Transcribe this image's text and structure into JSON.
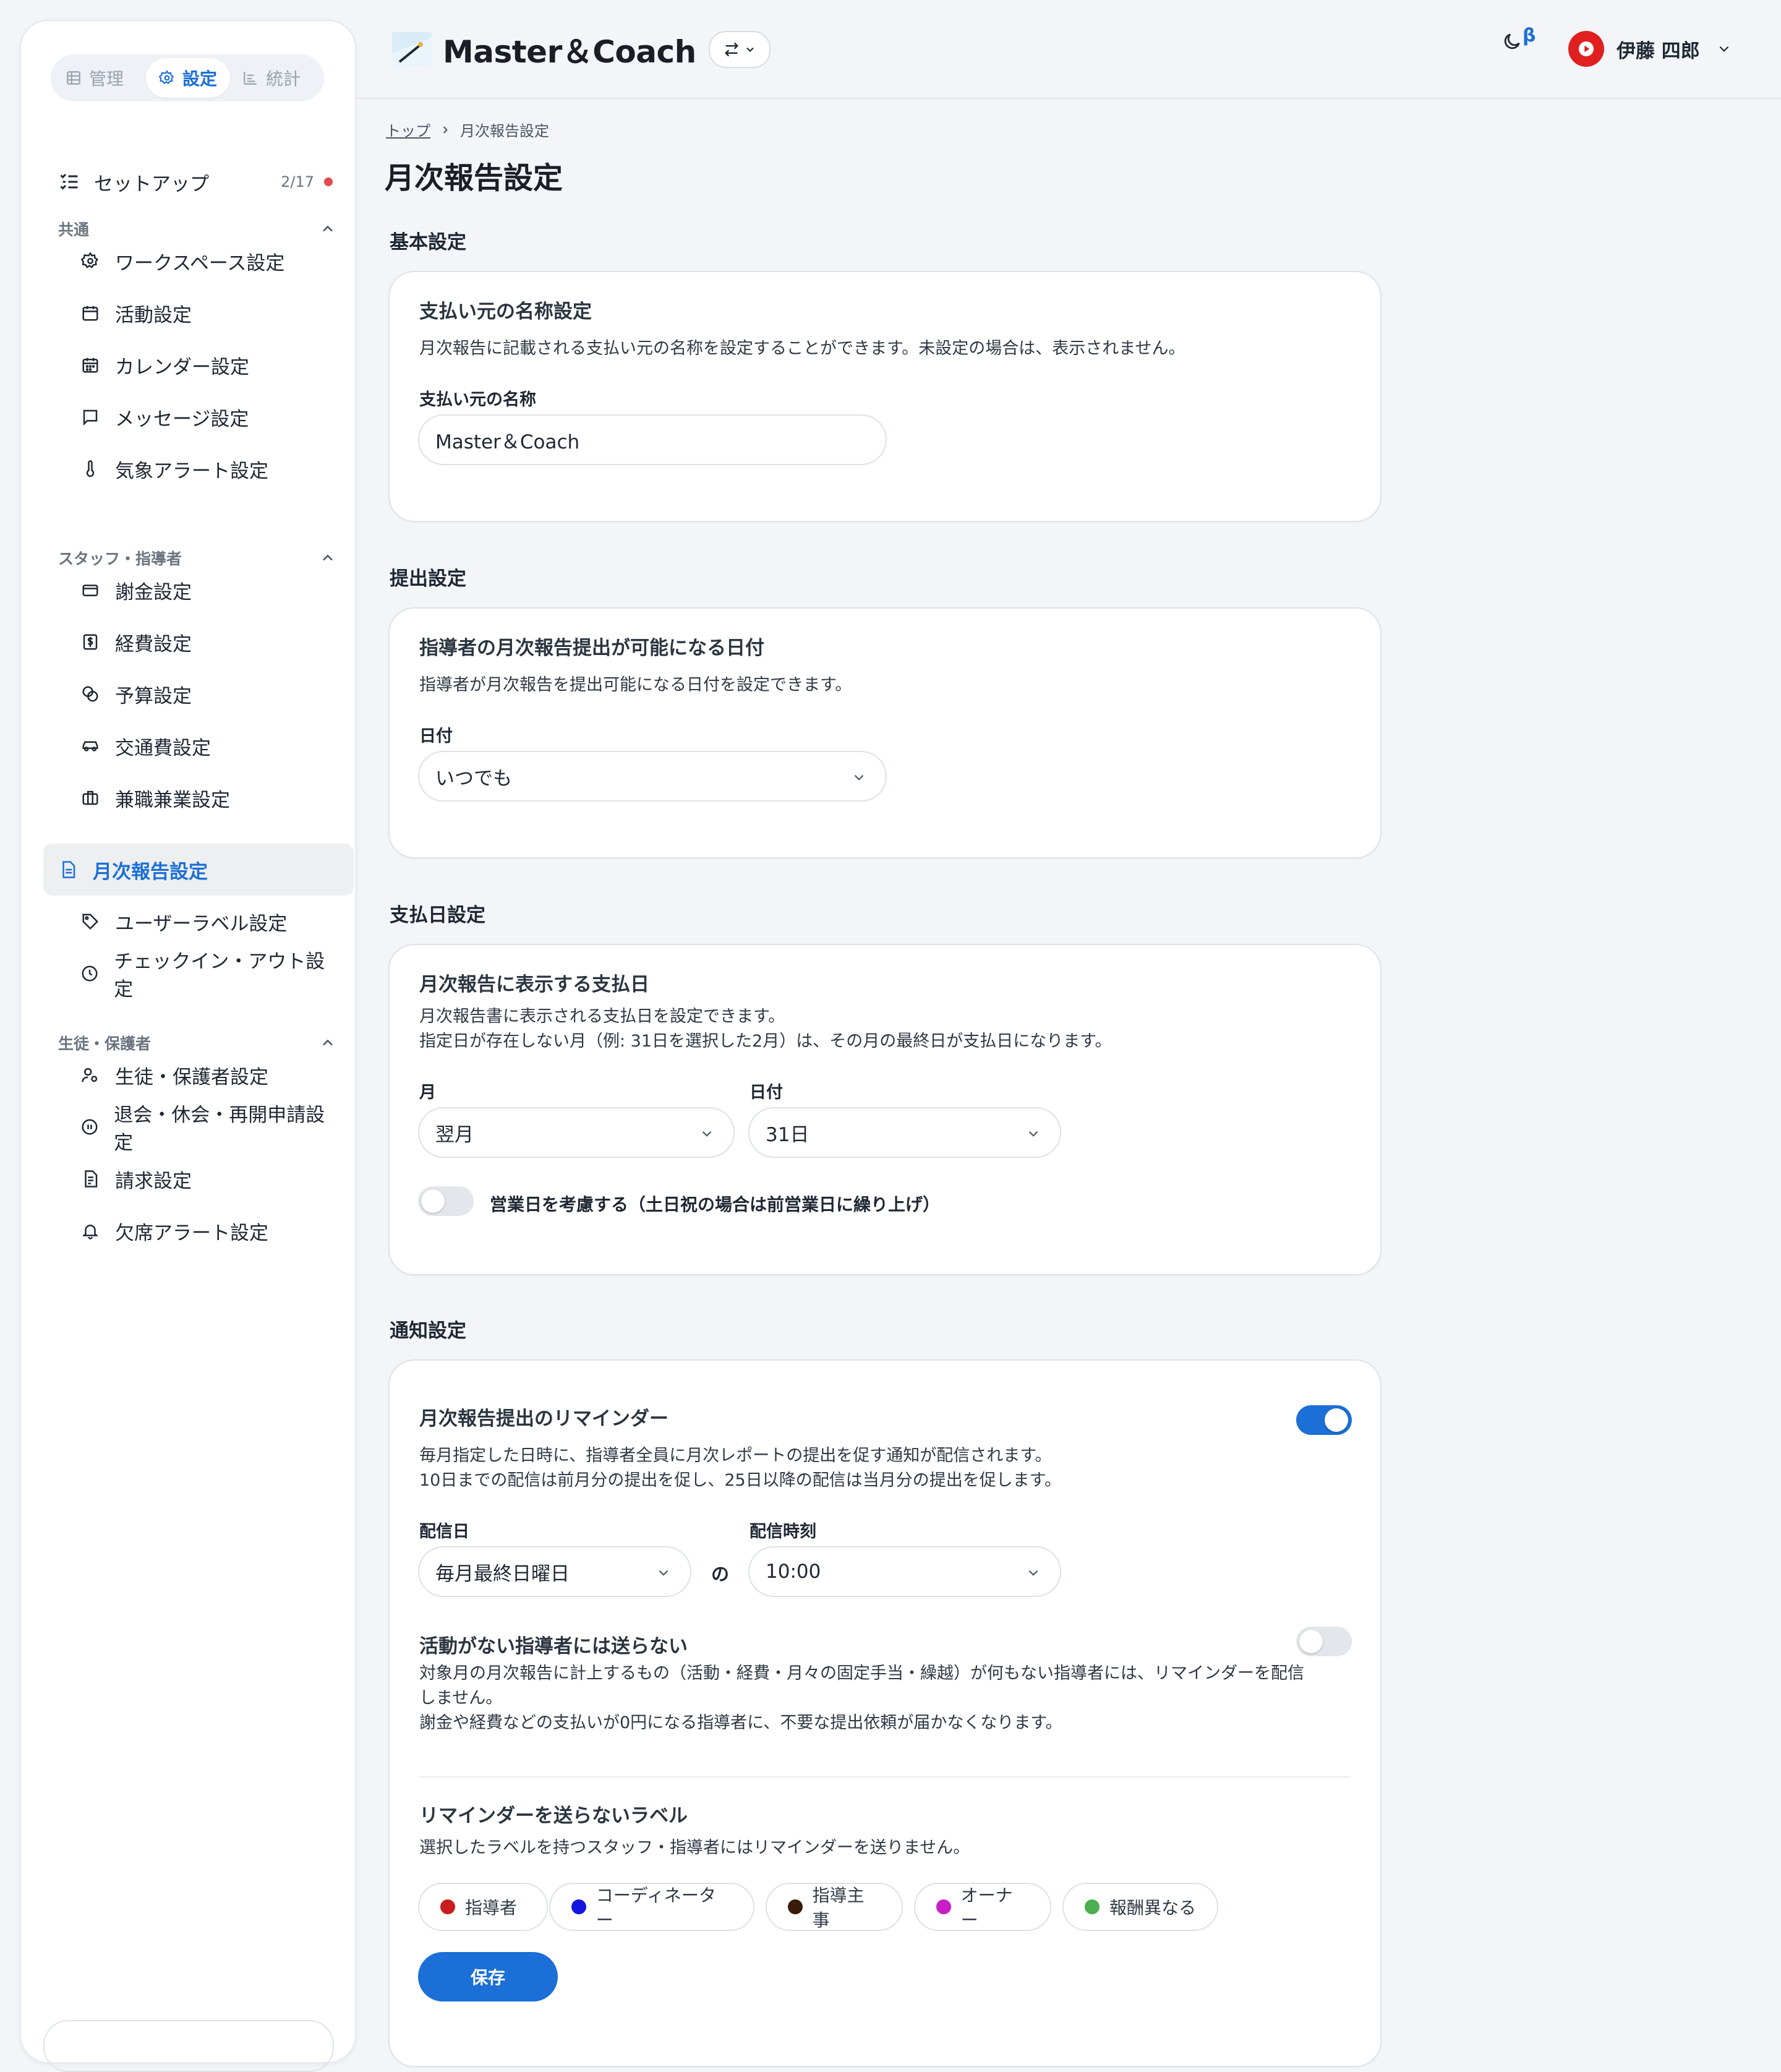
{
  "sidebar": {
    "segments": [
      {
        "label": "管理",
        "icon": "grid-icon"
      },
      {
        "label": "設定",
        "icon": "gear-icon"
      },
      {
        "label": "統計",
        "icon": "chart-icon"
      }
    ],
    "setup": {
      "label": "セットアップ",
      "progress": "2/17"
    },
    "sections": [
      {
        "title": "共通",
        "items": [
          "ワークスペース設定",
          "活動設定",
          "カレンダー設定",
          "メッセージ設定",
          "気象アラート設定"
        ]
      },
      {
        "title": "スタッフ・指導者",
        "items": [
          "謝金設定",
          "経費設定",
          "予算設定",
          "交通費設定",
          "兼職兼業設定",
          "月次報告設定",
          "ユーザーラベル設定",
          "チェックイン・アウト設定"
        ]
      },
      {
        "title": "生徒・保護者",
        "items": [
          "生徒・保護者設定",
          "退会・休会・再開申請設定",
          "請求設定",
          "欠席アラート設定"
        ]
      }
    ]
  },
  "header": {
    "brand": "Master＆Coach",
    "beta": "β",
    "user_name": "伊藤 四郎"
  },
  "breadcrumb": {
    "home": "トップ",
    "current": "月次報告設定"
  },
  "page_title": "月次報告設定",
  "basic": {
    "section": "基本設定",
    "title": "支払い元の名称設定",
    "desc": "月次報告に記載される支払い元の名称を設定することができます。未設定の場合は、表示されません。",
    "label": "支払い元の名称",
    "value": "Master＆Coach"
  },
  "submission": {
    "section": "提出設定",
    "title": "指導者の月次報告提出が可能になる日付",
    "desc": "指導者が月次報告を提出可能になる日付を設定できます。",
    "label": "日付",
    "value": "いつでも"
  },
  "payday": {
    "section": "支払日設定",
    "title": "月次報告に表示する支払日",
    "desc1": "月次報告書に表示される支払日を設定できます。",
    "desc2": "指定日が存在しない月（例: 31日を選択した2月）は、その月の最終日が支払日になります。",
    "month_label": "月",
    "month_value": "翌月",
    "day_label": "日付",
    "day_value": "31日",
    "toggle_label": "営業日を考慮する（土日祝の場合は前営業日に繰り上げ）",
    "toggle_on": false
  },
  "notify": {
    "section": "通知設定",
    "title": "月次報告提出のリマインダー",
    "toggle_on": true,
    "desc1": "毎月指定した日時に、指導者全員に月次レポートの提出を促す通知が配信されます。",
    "desc2": "10日までの配信は前月分の提出を促し、25日以降の配信は当月分の提出を促します。",
    "day_label": "配信日",
    "day_value": "毎月最終日曜日",
    "connector": "の",
    "time_label": "配信時刻",
    "time_value": "10:00",
    "inactive_title": "活動がない指導者には送らない",
    "inactive_on": false,
    "inactive_desc1": "対象月の月次報告に計上するもの（活動・経費・月々の固定手当・繰越）が何もない指導者には、リマインダーを配信",
    "inactive_desc2": "しません。",
    "inactive_desc3": "謝金や経費などの支払いが0円になる指導者に、不要な提出依頼が届かなくなります。",
    "labels_title": "リマインダーを送らないラベル",
    "labels_desc": "選択したラベルを持つスタッフ・指導者にはリマインダーを送りません。",
    "labels": [
      {
        "name": "指導者",
        "color": "#c81e1e"
      },
      {
        "name": "コーディネーター",
        "color": "#1515e0"
      },
      {
        "name": "指導主事",
        "color": "#3a1a0a"
      },
      {
        "name": "オーナー",
        "color": "#c81ec8"
      },
      {
        "name": "報酬異なる",
        "color": "#4caf50"
      }
    ],
    "save": "保存"
  },
  "colors": {
    "accent": "#1b6fd6",
    "alert_dot": "#e5484d",
    "avatar": "#e02020"
  }
}
